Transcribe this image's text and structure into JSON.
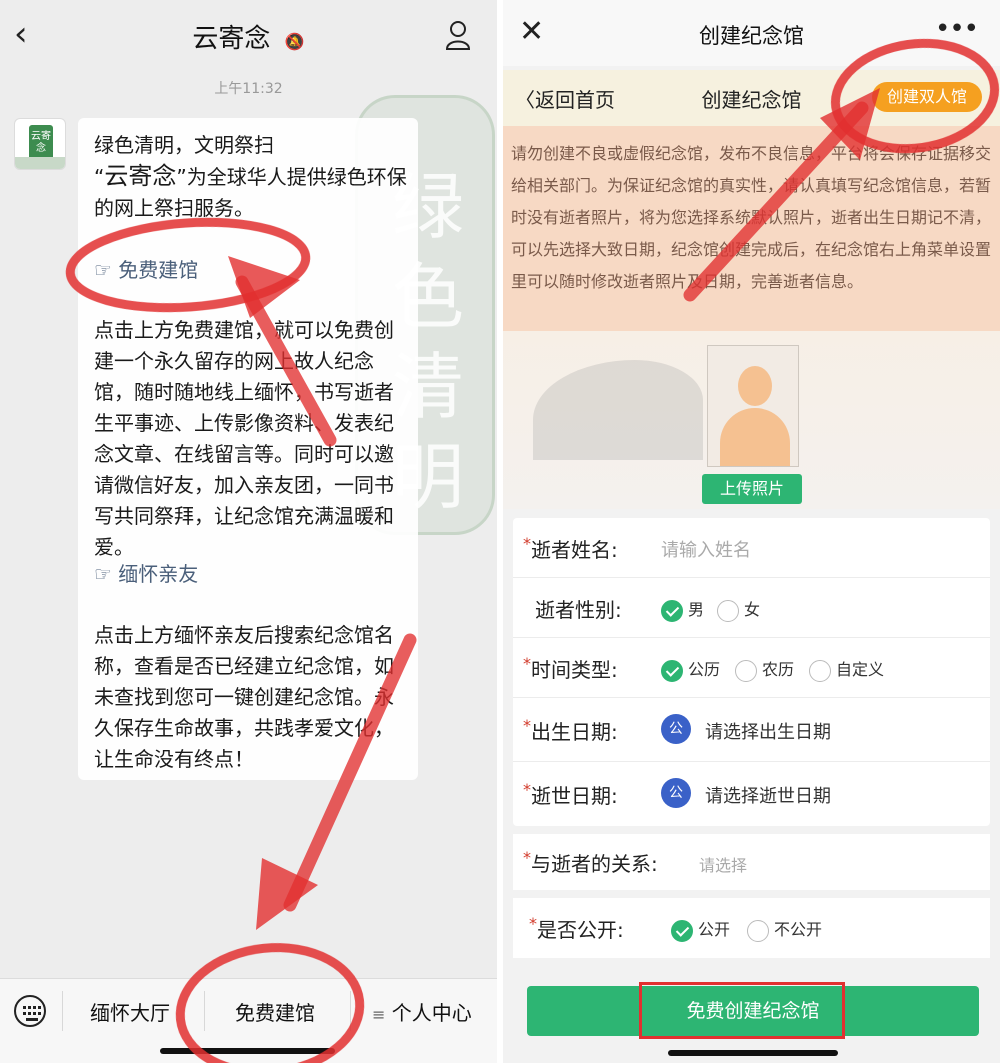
{
  "left": {
    "title": "云寄念",
    "mute_icons": "🔔̸ ",
    "time": "上午11:32",
    "avatar_text": "云寄念",
    "bubble": {
      "line1": "绿色清明，文明祭扫",
      "line2_a": "“",
      "line2_brand": "云寄念",
      "line2_b": "”为全球华人提供绿色环保的网上祭扫服务。",
      "link1": "☞ 免费建馆",
      "para1": "点击上方免费建馆，就可以免费创建一个永久留存的网上故人纪念馆，随时随地线上缅怀，书写逝者生平事迹、上传影像资料、发表纪念文章、在线留言等。同时可以邀请微信好友，加入亲友团，一同书写共同祭拜，让纪念馆充满温暖和爱。",
      "link2": "☞ 缅怀亲友",
      "para2": "点击上方缅怀亲友后搜索纪念馆名称，查看是否已经建立纪念馆，如未查找到您可一键创建纪念馆。永久保存生命故事，共践孝爱文化，让生命没有终点！"
    },
    "watermark": [
      "绿",
      "色",
      "清",
      "明"
    ],
    "bottom_menu": {
      "item1": "缅怀大厅",
      "item2": "免费建馆",
      "item3_prefix": "≡",
      "item3": "个人中心"
    }
  },
  "right": {
    "title": "创建纪念馆",
    "more": "•••",
    "back": "〈返回首页",
    "nav_title": "创建纪念馆",
    "double_button": "创建双人馆",
    "notice": "请勿创建不良或虚假纪念馆，发布不良信息，平台将会保存证据移交给相关部门。为保证纪念馆的真实性，请认真填写纪念馆信息，若暂时没有逝者照片，将为您选择系统默认照片，逝者出生日期记不清，可以先选择大致日期，纪念馆创建完成后，在纪念馆右上角菜单设置里可以随时修改逝者照片及日期，完善逝者信息。",
    "upload_button": "上传照片",
    "form": {
      "name_label": "逝者姓名:",
      "name_placeholder": "请输入姓名",
      "gender_label": "逝者性别:",
      "gender_male": "男",
      "gender_female": "女",
      "timetype_label": "时间类型:",
      "time_gregorian": "公历",
      "time_lunar": "农历",
      "time_custom": "自定义",
      "birth_label": "出生日期:",
      "gong": "公",
      "birth_placeholder": "请选择出生日期",
      "death_label": "逝世日期:",
      "death_placeholder": "请选择逝世日期",
      "relation_label": "与逝者的关系:",
      "relation_placeholder": "请选择",
      "public_label": "是否公开:",
      "public_yes": "公开",
      "public_no": "不公开"
    },
    "submit": "免费创建纪念馆"
  },
  "colors": {
    "accent_green": "#2db573",
    "annotation_red": "#e23030",
    "orange_button": "#f5a020",
    "notice_bg": "#f7d9c4",
    "date_badge_blue": "#3a61c8"
  }
}
